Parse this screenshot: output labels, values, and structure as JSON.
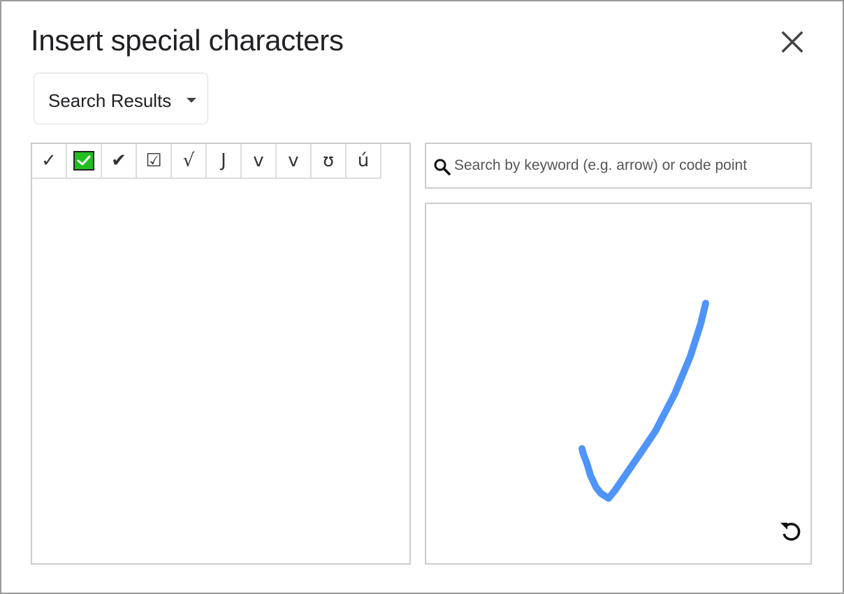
{
  "dialog": {
    "title": "Insert special characters",
    "close_icon": "close-icon"
  },
  "category_dropdown": {
    "selected": "Search Results",
    "icon": "caret-down-icon"
  },
  "results": {
    "characters": [
      {
        "char": "✓",
        "name": "check-mark"
      },
      {
        "char": "✅",
        "name": "white-heavy-check-mark",
        "style": "green-box"
      },
      {
        "char": "✔",
        "name": "heavy-check-mark"
      },
      {
        "char": "☑",
        "name": "ballot-box-with-check"
      },
      {
        "char": "√",
        "name": "square-root"
      },
      {
        "char": "J",
        "name": "letter-j"
      },
      {
        "char": "v",
        "name": "letter-v"
      },
      {
        "char": "v",
        "name": "letter-v-alt"
      },
      {
        "char": "ʊ",
        "name": "latin-upsilon"
      },
      {
        "char": "ú",
        "name": "u-acute"
      }
    ],
    "green_box_color": "#1fbf1f"
  },
  "search": {
    "icon": "search-icon",
    "value": "",
    "placeholder": "Search by keyword (e.g. arrow) or code point"
  },
  "drawing": {
    "stroke_color": "#4f94f8",
    "undo_icon": "undo-icon"
  }
}
